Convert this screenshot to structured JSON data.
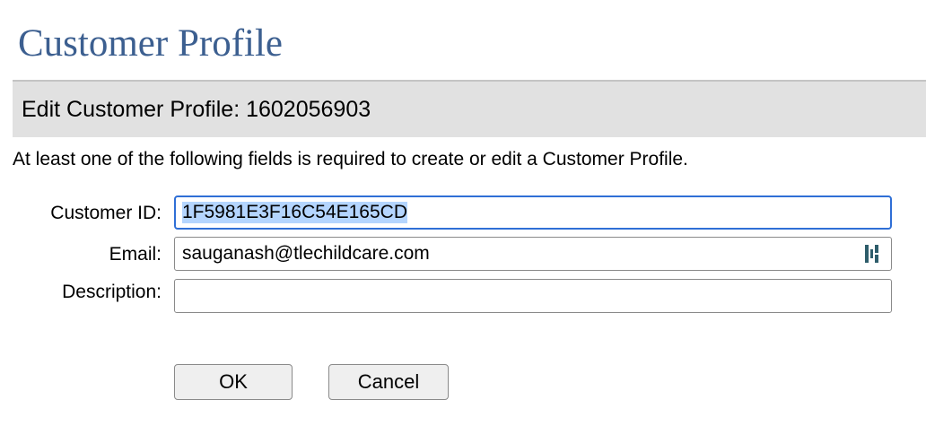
{
  "page": {
    "title": "Customer Profile"
  },
  "section": {
    "title": "Edit Customer Profile: 1602056903"
  },
  "instructions": "At least one of the following fields is required to create or edit a Customer Profile.",
  "form": {
    "customer_id": {
      "label": "Customer ID:",
      "value": "1F5981E3F16C54E165CD",
      "text_selected": true
    },
    "email": {
      "label": "Email:",
      "value": "sauganash@tlechildcare.com",
      "password_manager_icon": "keeper-icon"
    },
    "description": {
      "label": "Description:",
      "value": ""
    }
  },
  "buttons": {
    "ok": "OK",
    "cancel": "Cancel"
  },
  "colors": {
    "title": "#3c5f90",
    "section_bar": "#e1e1e1",
    "focus_border": "#2f6fd6",
    "selection": "#b4d5fe",
    "icon": "#2e5d6b"
  }
}
